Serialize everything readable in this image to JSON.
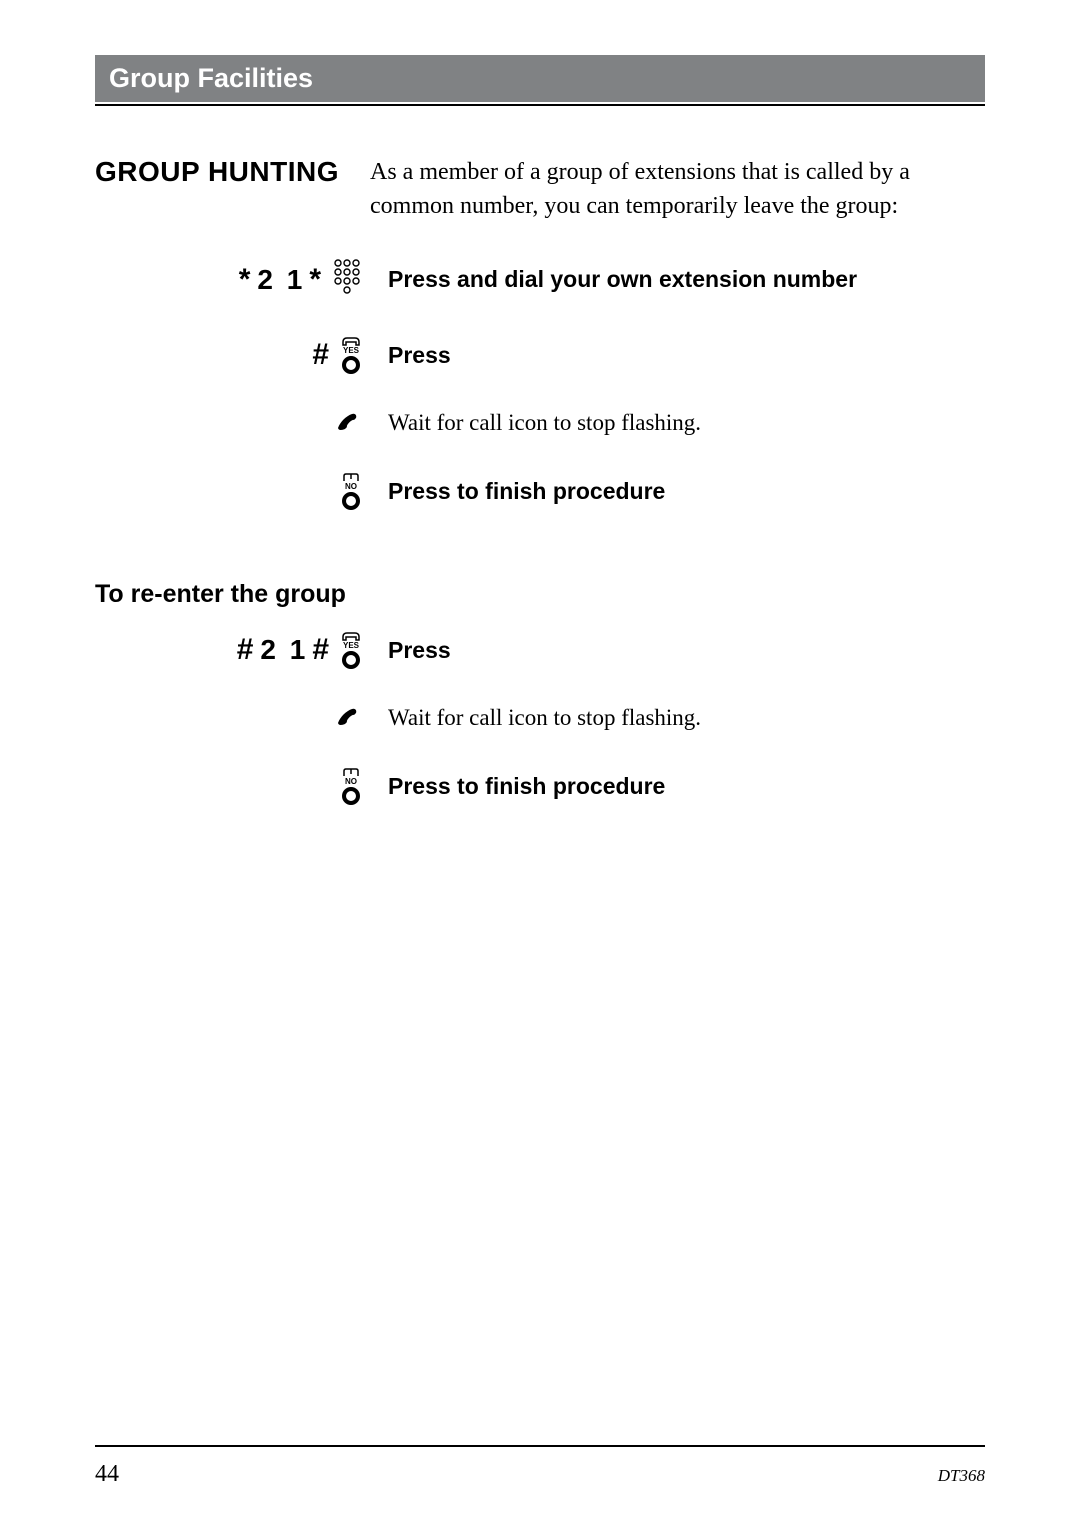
{
  "header": {
    "title": "Group Facilities"
  },
  "section": {
    "title": "GROUP HUNTING",
    "intro": "As a member of a group of extensions that is called by a common number, you can temporarily leave the group:"
  },
  "dial1": {
    "star": "*",
    "code": "2 1"
  },
  "steps": {
    "s1": "Press and dial your own extension number",
    "hash": "#",
    "s2": "Press",
    "s3": "Wait for call icon to stop flashing.",
    "s4": "Press to finish procedure"
  },
  "sub": {
    "title": "To re-enter the group"
  },
  "dial2": {
    "hash": "#",
    "code": "2 1"
  },
  "steps2": {
    "s1": "Press",
    "s2": "Wait for call icon to stop flashing.",
    "s3": "Press to finish procedure"
  },
  "labels": {
    "yes": "YES",
    "no": "NO"
  },
  "footer": {
    "page": "44",
    "doc": "DT368"
  }
}
